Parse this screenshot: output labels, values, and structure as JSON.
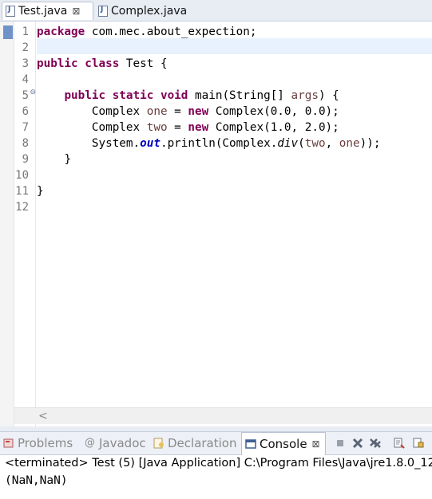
{
  "editor_tabs": [
    {
      "label": "Test.java",
      "icon": "java-file-icon",
      "close": "⊠"
    },
    {
      "label": "Complex.java",
      "icon": "java-file-icon"
    }
  ],
  "line_numbers": [
    "1",
    "2",
    "3",
    "4",
    "5",
    "6",
    "7",
    "8",
    "9",
    "10",
    "11",
    "12"
  ],
  "code": {
    "l1": {
      "kw": "package",
      "rest": " com.mec.about_expection;"
    },
    "l3": {
      "kw1": "public",
      "kw2": "class",
      "rest": " Test {"
    },
    "l5": {
      "kw1": "public",
      "kw2": "static",
      "kw3": "void",
      "rest": " main(String[] ",
      "arg": "args",
      "end": ") {"
    },
    "l6": {
      "pre": "Complex ",
      "var": "one",
      "mid": " = ",
      "kw": "new",
      "rest": " Complex(0.0, 0.0);"
    },
    "l7": {
      "pre": "Complex ",
      "var": "two",
      "mid": " = ",
      "kw": "new",
      "rest": " Complex(1.0, 2.0);"
    },
    "l8": {
      "pre": "System.",
      "field": "out",
      "mid": ".println(Complex.",
      "method": "div",
      "open": "(",
      "v1": "two",
      "comma": ", ",
      "v2": "one",
      "end": "));"
    },
    "l9": "}",
    "l11": "}"
  },
  "views": [
    {
      "label": "Problems",
      "icon": "problems-icon"
    },
    {
      "label": "Javadoc",
      "icon": "javadoc-icon"
    },
    {
      "label": "Declaration",
      "icon": "declaration-icon"
    },
    {
      "label": "Console",
      "icon": "console-icon",
      "close": "⊠"
    }
  ],
  "console": {
    "status": "<terminated> Test (5) [Java Application] C:\\Program Files\\Java\\jre1.8.0_12",
    "output": "(NaN,NaN)"
  },
  "colors": {
    "keyword": "#7f0055",
    "variable": "#6a3e3e",
    "static_field": "#0000c0",
    "current_line": "#e8f2fe"
  }
}
